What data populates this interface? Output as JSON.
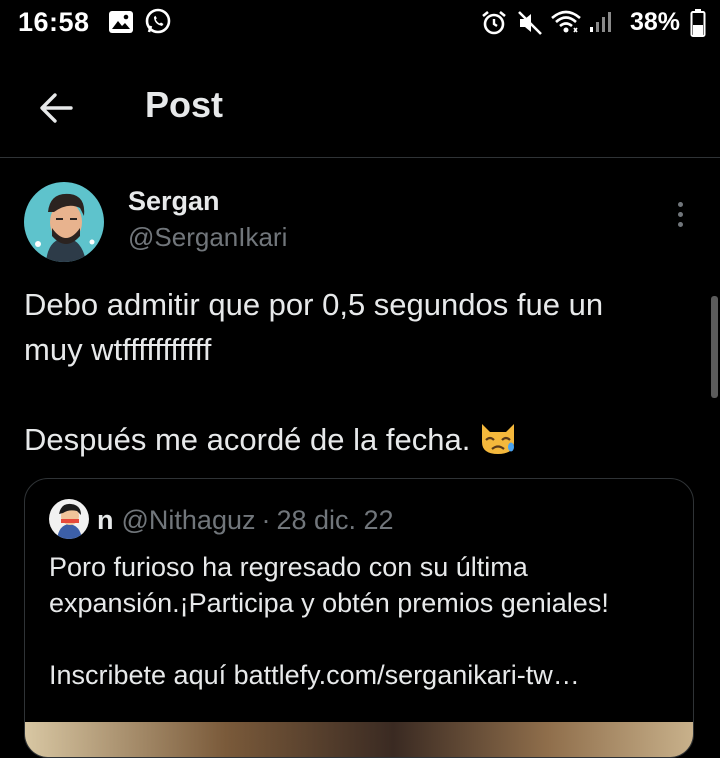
{
  "status_bar": {
    "time": "16:58",
    "battery": "38%"
  },
  "header": {
    "title": "Post"
  },
  "post": {
    "author": {
      "display_name": "Sergan",
      "handle": "@SerganIkari"
    },
    "text_lines": [
      "Debo admitir que por 0,5 segundos fue un",
      "muy wtfffffffffff",
      "",
      "Después me acordé de la fecha."
    ],
    "emoji": "crying-cat-face"
  },
  "quoted_post": {
    "display_name": "n",
    "handle": "@Nithaguz",
    "separator": "·",
    "date": "28 dic. 22",
    "text_lines": [
      "Poro furioso ha regresado con su última",
      "expansión.¡Participa y obtén premios geniales!",
      "",
      "Inscribete aquí  battlefy.com/serganikari-tw…"
    ]
  },
  "colors": {
    "background": "#000000",
    "text_primary": "#e7e9ea",
    "text_secondary": "#71767b",
    "divider": "#2f3336"
  },
  "icons": {
    "status_left": [
      "image-icon",
      "whatsapp-icon"
    ],
    "status_right": [
      "alarm-icon",
      "mute-icon",
      "wifi-icon",
      "signal-icon",
      "battery-icon"
    ],
    "header": [
      "back-arrow-icon"
    ],
    "post": [
      "more-vertical-icon"
    ]
  }
}
